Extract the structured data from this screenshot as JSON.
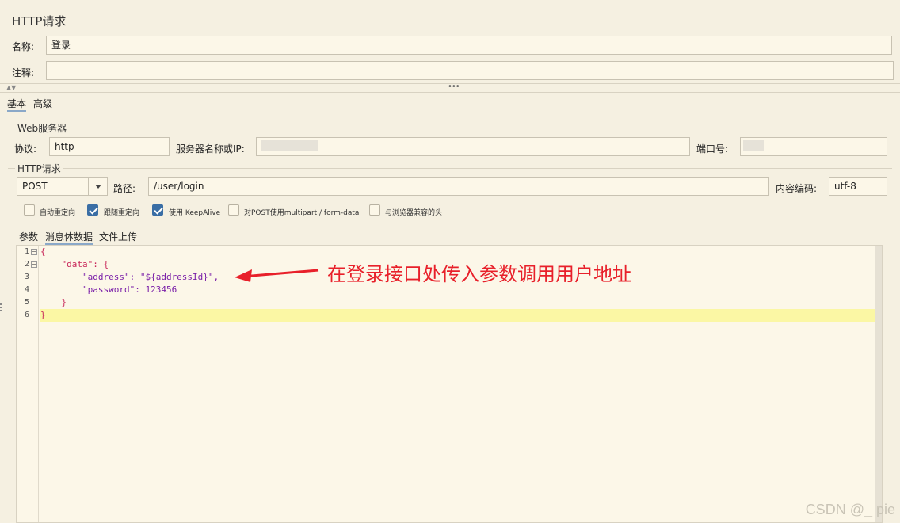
{
  "panel": {
    "title": "HTTP请求",
    "name_label": "名称:",
    "name_value": "登录",
    "comment_label": "注释:",
    "comment_value": ""
  },
  "tabs": {
    "basic": "基本",
    "advanced": "高级"
  },
  "web_server": {
    "legend": "Web服务器",
    "protocol_label": "协议:",
    "protocol_value": "http",
    "server_label": "服务器名称或IP:",
    "server_value": "",
    "port_label": "端口号:",
    "port_value": ""
  },
  "http_request": {
    "legend": "HTTP请求",
    "method": "POST",
    "path_label": "路径:",
    "path_value": "/user/login",
    "encoding_label": "内容编码:",
    "encoding_value": "utf-8"
  },
  "options": [
    {
      "label": "自动重定向",
      "checked": false
    },
    {
      "label": "跟随重定向",
      "checked": true
    },
    {
      "label": "使用 KeepAlive",
      "checked": true
    },
    {
      "label": "对POST使用multipart / form-data",
      "checked": false
    },
    {
      "label": "与浏览器兼容的头",
      "checked": false
    }
  ],
  "subtabs": {
    "params": "参数",
    "body": "消息体数据",
    "files": "文件上传"
  },
  "editor": {
    "lines": [
      "1",
      "2",
      "3",
      "4",
      "5",
      "6"
    ],
    "code": [
      "{",
      "    \"data\": {",
      "        \"address\": \"${addressId}\",",
      "        \"password\": 123456",
      "    }",
      "}"
    ]
  },
  "annotation": "在登录接口处传入参数调用用户地址",
  "watermark": "CSDN @_ pie"
}
